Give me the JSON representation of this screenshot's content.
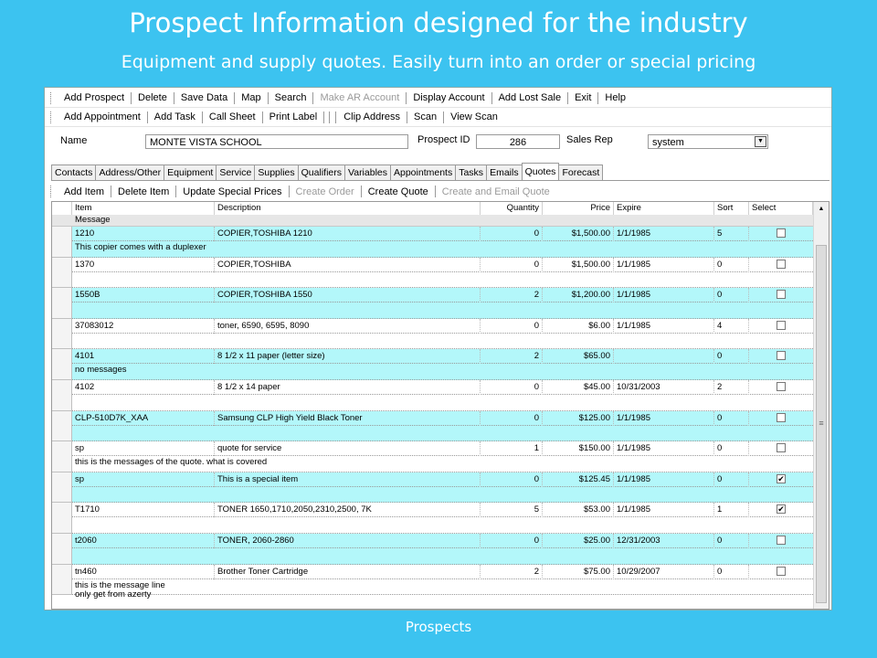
{
  "slide": {
    "title": "Prospect Information designed for the industry",
    "subtitle": "Equipment and supply quotes. Easily turn into an order or special pricing",
    "footer": "Prospects"
  },
  "toolbar1": [
    {
      "label": "Add Prospect",
      "enabled": true
    },
    {
      "label": "Delete",
      "enabled": true
    },
    {
      "label": "Save Data",
      "enabled": true
    },
    {
      "label": "Map",
      "enabled": true
    },
    {
      "label": "Search",
      "enabled": true
    },
    {
      "label": "Make AR Account",
      "enabled": false
    },
    {
      "label": "Display Account",
      "enabled": true
    },
    {
      "label": "Add Lost Sale",
      "enabled": true
    },
    {
      "label": "Exit",
      "enabled": true
    },
    {
      "label": "Help",
      "enabled": true
    }
  ],
  "toolbar2": [
    {
      "label": "Add Appointment",
      "enabled": true
    },
    {
      "label": "Add Task",
      "enabled": true
    },
    {
      "label": "Call Sheet",
      "enabled": true
    },
    {
      "label": "Print Label",
      "enabled": true
    },
    {
      "label": "Clip Address",
      "enabled": true
    },
    {
      "label": "Scan",
      "enabled": true
    },
    {
      "label": "View Scan",
      "enabled": true
    }
  ],
  "form": {
    "name_label": "Name",
    "name_value": "MONTE VISTA SCHOOL",
    "prospect_id_label": "Prospect ID",
    "prospect_id_value": "286",
    "sales_rep_label": "Sales Rep",
    "sales_rep_value": "system"
  },
  "tabs": [
    {
      "label": "Contacts"
    },
    {
      "label": "Address/Other"
    },
    {
      "label": "Equipment"
    },
    {
      "label": "Service"
    },
    {
      "label": "Supplies"
    },
    {
      "label": "Qualifiers"
    },
    {
      "label": "Variables"
    },
    {
      "label": "Appointments"
    },
    {
      "label": "Tasks"
    },
    {
      "label": "Emails"
    },
    {
      "label": "Quotes",
      "active": true
    },
    {
      "label": "Forecast"
    }
  ],
  "toolbar3": [
    {
      "label": "Add Item",
      "enabled": true
    },
    {
      "label": "Delete Item",
      "enabled": true
    },
    {
      "label": "Update Special Prices",
      "enabled": true
    },
    {
      "label": "Create Order",
      "enabled": false
    },
    {
      "label": "Create Quote",
      "enabled": true
    },
    {
      "label": "Create and Email Quote",
      "enabled": false
    }
  ],
  "grid": {
    "columns": {
      "item": "Item",
      "description": "Description",
      "quantity": "Quantity",
      "price": "Price",
      "expire": "Expire",
      "sort": "Sort",
      "select": "Select"
    },
    "message_header": "Message",
    "rows": [
      {
        "item": "1210",
        "description": "COPIER,TOSHIBA 1210",
        "quantity": "0",
        "price": "$1,500.00",
        "expire": "1/1/1985",
        "sort": "5",
        "selected": false,
        "message": "This copier comes with a duplexer",
        "style": "cyan"
      },
      {
        "item": "1370",
        "description": "COPIER,TOSHIBA",
        "quantity": "0",
        "price": "$1,500.00",
        "expire": "1/1/1985",
        "sort": "0",
        "selected": false,
        "message": "",
        "style": "white"
      },
      {
        "item": "1550B",
        "description": "COPIER,TOSHIBA 1550",
        "quantity": "2",
        "price": "$1,200.00",
        "expire": "1/1/1985",
        "sort": "0",
        "selected": false,
        "message": "",
        "style": "cyan"
      },
      {
        "item": "37083012",
        "description": "toner, 6590, 6595, 8090",
        "quantity": "0",
        "price": "$6.00",
        "expire": "1/1/1985",
        "sort": "4",
        "selected": false,
        "message": "",
        "style": "white"
      },
      {
        "item": "4101",
        "description": "8 1/2 x 11 paper (letter size)",
        "quantity": "2",
        "price": "$65.00",
        "expire": "",
        "sort": "0",
        "selected": false,
        "message": "no messages",
        "style": "cyan"
      },
      {
        "item": "4102",
        "description": "8 1/2 x 14 paper",
        "quantity": "0",
        "price": "$45.00",
        "expire": "10/31/2003",
        "sort": "2",
        "selected": false,
        "message": "",
        "style": "white"
      },
      {
        "item": "CLP-510D7K_XAA",
        "description": "Samsung CLP High Yield Black Toner",
        "quantity": "0",
        "price": "$125.00",
        "expire": "1/1/1985",
        "sort": "0",
        "selected": false,
        "message": "",
        "style": "cyan"
      },
      {
        "item": "sp",
        "description": "quote for service",
        "quantity": "1",
        "price": "$150.00",
        "expire": "1/1/1985",
        "sort": "0",
        "selected": false,
        "message": "this is the messages of the quote.  what is covered",
        "style": "white"
      },
      {
        "item": "sp",
        "description": "This is a special item",
        "quantity": "0",
        "price": "$125.45",
        "expire": "1/1/1985",
        "sort": "0",
        "selected": true,
        "message": "",
        "style": "cyan"
      },
      {
        "item": "T1710",
        "description": "TONER 1650,1710,2050,2310,2500, 7K",
        "quantity": "5",
        "price": "$53.00",
        "expire": "1/1/1985",
        "sort": "1",
        "selected": true,
        "message": "",
        "style": "white"
      },
      {
        "item": "t2060",
        "description": "TONER, 2060-2860",
        "quantity": "0",
        "price": "$25.00",
        "expire": "12/31/2003",
        "sort": "0",
        "selected": false,
        "message": "",
        "style": "cyan"
      },
      {
        "item": "tn460",
        "description": "Brother Toner Cartridge",
        "quantity": "2",
        "price": "$75.00",
        "expire": "10/29/2007",
        "sort": "0",
        "selected": false,
        "message": "this is the message line\nonly get from azerty",
        "style": "white"
      }
    ]
  }
}
